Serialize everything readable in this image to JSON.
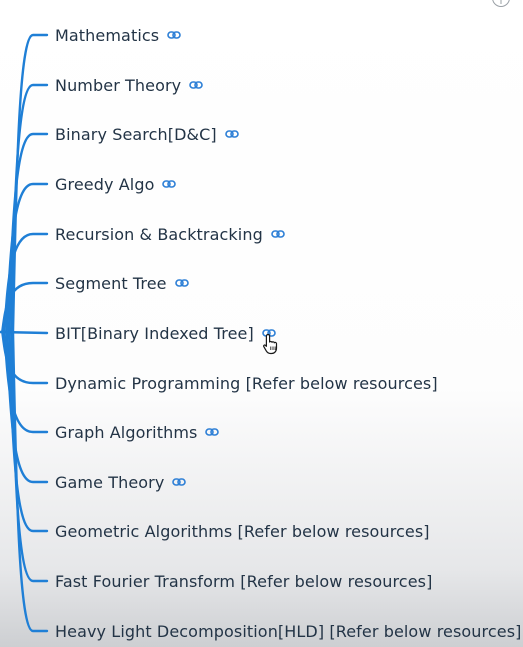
{
  "topics": [
    {
      "label": "Mathematics",
      "has_link": true
    },
    {
      "label": "Number Theory",
      "has_link": true
    },
    {
      "label": "Binary Search[D&C]",
      "has_link": true
    },
    {
      "label": "Greedy Algo",
      "has_link": true
    },
    {
      "label": "Recursion & Backtracking",
      "has_link": true
    },
    {
      "label": "Segment Tree",
      "has_link": true
    },
    {
      "label": "BIT[Binary Indexed Tree]",
      "has_link": true
    },
    {
      "label": "Dynamic Programming [Refer below resources]",
      "has_link": false
    },
    {
      "label": "Graph Algorithms",
      "has_link": true
    },
    {
      "label": "Game Theory",
      "has_link": true
    },
    {
      "label": "Geometric Algorithms [Refer below resources]",
      "has_link": false
    },
    {
      "label": "Fast Fourier Transform [Refer below resources]",
      "has_link": false
    },
    {
      "label": "Heavy Light Decomposition[HLD] [Refer below resources]",
      "has_link": false
    }
  ],
  "colors": {
    "branch": "#1f7fd6",
    "text": "#233446",
    "link_icon": "#2d7fd6"
  },
  "icons": {
    "link": "link-icon",
    "cursor": "hand-pointer-icon",
    "corner": "info-circle-icon"
  }
}
